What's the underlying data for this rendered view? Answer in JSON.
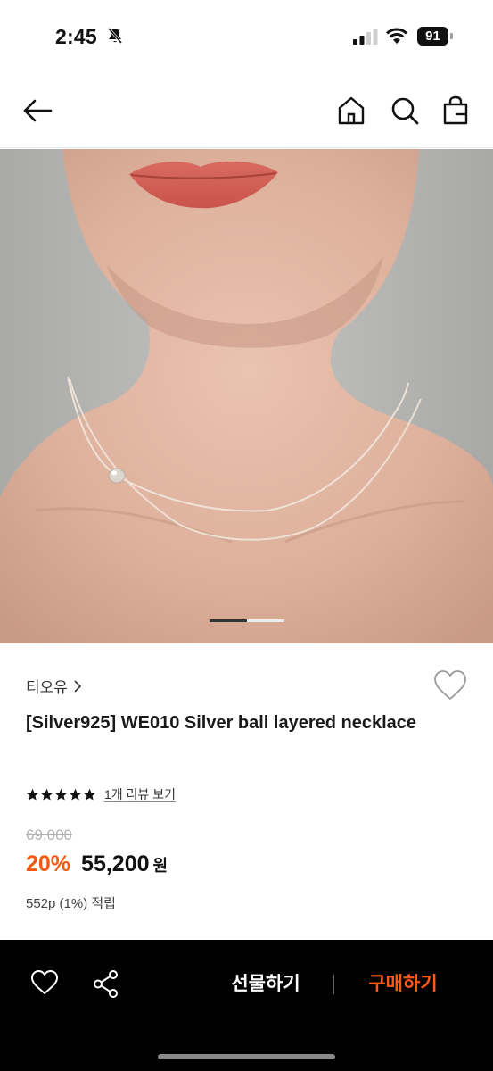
{
  "status_bar": {
    "time": "2:45",
    "battery": "91",
    "icons": [
      "bell-slash-icon",
      "signal-icon",
      "wifi-icon",
      "battery-icon"
    ]
  },
  "nav": {
    "icons": [
      "back-arrow-icon",
      "home-icon",
      "search-icon",
      "shopping-bag-icon"
    ]
  },
  "hero": {
    "image": "model wearing layered silver necklace",
    "page_indicator": {
      "current": 1,
      "total": 2
    }
  },
  "product": {
    "brand": "티오유",
    "title": "[Silver925] WE010 Silver ball layered necklace",
    "rating_stars": 5,
    "review_link": "1개 리뷰 보기",
    "original_price": "69,000",
    "discount": "20%",
    "sale_price": "55,200",
    "currency": "원",
    "points": "552p (1%) 적립"
  },
  "bottom_bar": {
    "gift_label": "선물하기",
    "buy_label": "구매하기",
    "icons": [
      "heart-icon",
      "share-icon"
    ]
  },
  "colors": {
    "accent": "#f25a12",
    "buy_text": "#ff5a14",
    "bottom_bar_bg": "#000000"
  }
}
